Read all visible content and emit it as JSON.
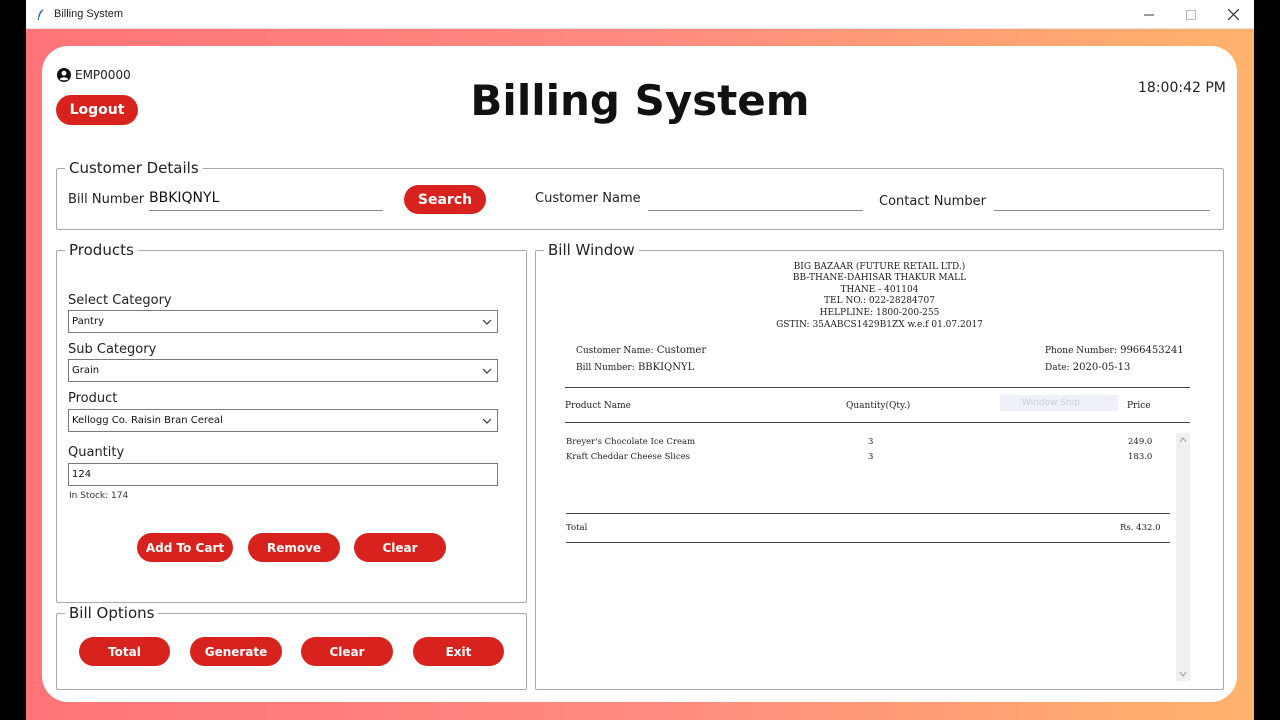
{
  "window": {
    "title": "Billing System"
  },
  "header": {
    "employee_id": "EMP0000",
    "logout_label": "Logout",
    "app_title": "Billing System",
    "time": "18:00:42 PM"
  },
  "customer": {
    "legend": "Customer Details",
    "bill_number_label": "Bill Number",
    "bill_number_value": "BBKIQNYL",
    "search_label": "Search",
    "customer_name_label": "Customer Name",
    "customer_name_value": "",
    "contact_number_label": "Contact Number",
    "contact_number_value": ""
  },
  "products": {
    "legend": "Products",
    "category_label": "Select Category",
    "category_value": "Pantry",
    "subcategory_label": "Sub Category",
    "subcategory_value": "Grain",
    "product_label": "Product",
    "product_value": "Kellogg Co. Raisin Bran Cereal",
    "quantity_label": "Quantity",
    "quantity_value": "124",
    "stock_text": "In Stock: 174",
    "add_label": "Add To Cart",
    "remove_label": "Remove",
    "clear_label": "Clear"
  },
  "bill_options": {
    "legend": "Bill Options",
    "total_label": "Total",
    "generate_label": "Generate",
    "clear_label": "Clear",
    "exit_label": "Exit"
  },
  "bill_window": {
    "legend": "Bill Window",
    "store_lines": [
      "BIG BAZAAR (FUTURE RETAIL LTD.)",
      "BB-THANE-DAHISAR THAKUR MALL",
      "THANE - 401104",
      "TEL NO.: 022-28284707",
      "HELPLINE: 1800-200-255",
      "GSTIN: 35AABCS1429B1ZX w.e.f 01.07.2017"
    ],
    "customer_name_label": "Customer Name:",
    "customer_name": "Customer",
    "bill_number_label": "Bill Number:",
    "bill_number": "BBKIQNYL",
    "phone_label": "Phone Number:",
    "phone": "9966453241",
    "date_label": "Date:",
    "date": "2020-05-13",
    "col_product": "Product Name",
    "col_qty": "Quantity(Qty.)",
    "col_price": "Price",
    "items": [
      {
        "name": "Breyer's Chocolate Ice Cream",
        "qty": "3",
        "price": "249.0"
      },
      {
        "name": "Kraft Cheddar Cheese Slices",
        "qty": "3",
        "price": "183.0"
      }
    ],
    "total_label": "Total",
    "total_value": "Rs. 432.0",
    "ghost_text": "Window Snip"
  }
}
